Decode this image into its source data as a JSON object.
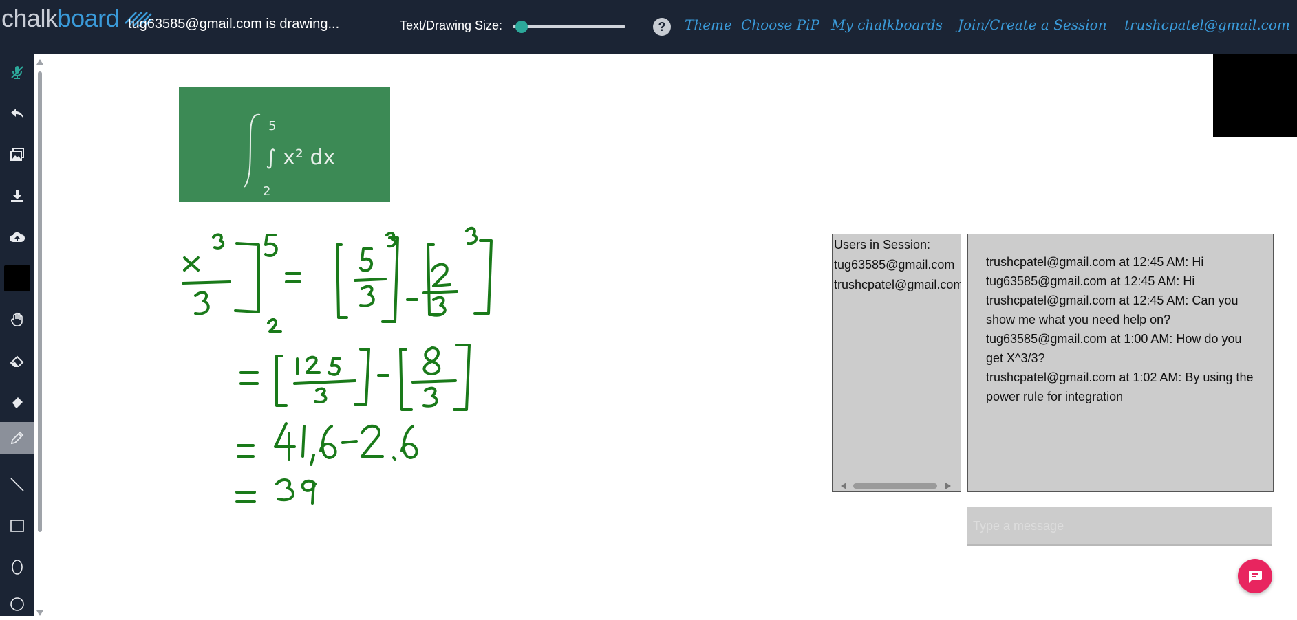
{
  "app": {
    "logo_part1": "chalk",
    "logo_part2": "board",
    "drawing_status": "tug63585@gmail.com is drawing...",
    "size_label": "Text/Drawing Size:",
    "size_level": 0.03,
    "accent_color": "#3a9ad9",
    "topbar_color": "#1b2434"
  },
  "nav": {
    "help": "?",
    "theme": "Theme",
    "choose_pip": "Choose PiP",
    "my_chalkboards": "My chalkboards",
    "join_create": "Join/Create a Session",
    "account": "trushcpatel@gmail.com"
  },
  "tools": [
    {
      "icon": "microphone-icon"
    },
    {
      "icon": "undo-icon"
    },
    {
      "icon": "image-icon"
    },
    {
      "icon": "download-icon"
    },
    {
      "icon": "cloud-upload-icon"
    },
    {
      "icon": "color-swatch-icon",
      "color": "#000000"
    },
    {
      "icon": "hand-icon"
    },
    {
      "icon": "clear-icon"
    },
    {
      "icon": "eraser-icon"
    },
    {
      "icon": "pencil-icon",
      "active": true
    },
    {
      "icon": "line-icon"
    },
    {
      "icon": "rectangle-icon"
    },
    {
      "icon": "ellipse-icon"
    },
    {
      "icon": "circle-icon"
    }
  ],
  "board": {
    "image_text": "∫ x² dx",
    "image_lower": "2",
    "image_upper": "5",
    "ink_color": "#1a7a1a"
  },
  "users": {
    "title": "Users in Session:",
    "list": [
      "tug63585@gmail.com",
      "trushcpatel@gmail.com"
    ]
  },
  "chat": {
    "messages": [
      "trushcpatel@gmail.com at 12:45 AM: Hi",
      "tug63585@gmail.com at 12:45 AM: Hi",
      "trushcpatel@gmail.com at 12:45 AM: Can you show me what you need help on?",
      "tug63585@gmail.com at 1:00 AM: How do you get X^3/3?",
      "trushcpatel@gmail.com at 1:02 AM: By using the power rule for integration"
    ],
    "placeholder": "Type a message"
  }
}
